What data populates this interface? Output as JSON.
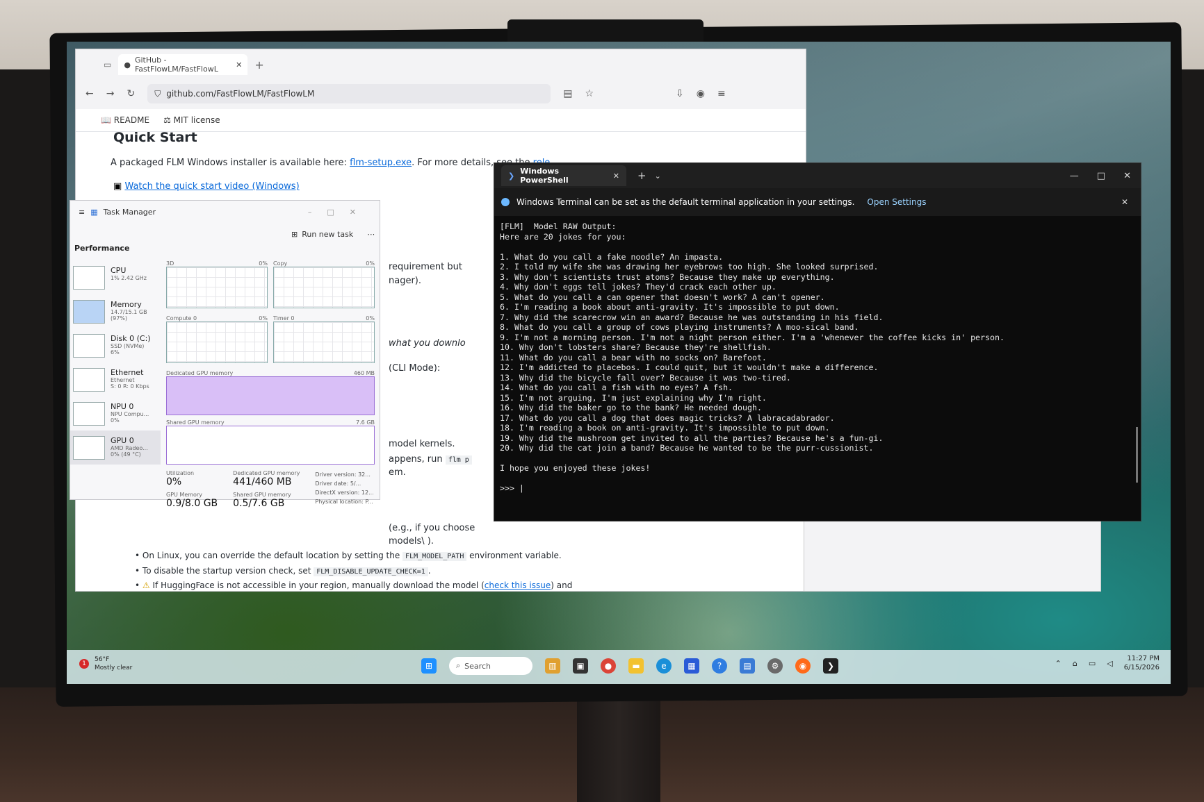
{
  "browser": {
    "tab_title": "GitHub - FastFlowLM/FastFlowL",
    "url": "github.com/FastFlowLM/FastFlowLM",
    "readme_tab": "README",
    "license_tab": "MIT license",
    "section_title": "Quick Start",
    "intro_text": "A packaged FLM Windows installer is available here:",
    "installer_link": "flm-setup.exe",
    "details_text": ". For more details, see the",
    "release_link": "rele",
    "video_link": "Watch the quick start video (Windows)",
    "frag_requirement": "requirement but",
    "frag_manager": "nager).",
    "frag_download": "what you downlo",
    "frag_cli": "(CLI Mode):",
    "frag_kernels": "model kernels.",
    "frag_appens": "appens, run",
    "frag_appens_code": "flm p",
    "frag_em": "em.",
    "frag_eg": "(e.g., if you choose",
    "frag_models": "models\\ ).",
    "bullet1_pre": "On Linux, you can override the default location by setting the",
    "bullet1_code": "FLM_MODEL_PATH",
    "bullet1_post": "environment variable.",
    "bullet2_pre": "To disable the startup version check, set",
    "bullet2_code": "FLM_DISABLE_UPDATE_CHECK=1",
    "bullet2_post": ".",
    "bullet3_pre": "If HuggingFace is not accessible in your region, manually download the model (",
    "bullet3_link": "check this issue",
    "bullet3_post": ") and"
  },
  "taskmgr": {
    "title": "Task Manager",
    "run_new_task": "Run new task",
    "performance": "Performance",
    "side": [
      {
        "name": "CPU",
        "sub1": "1% 2.42 GHz",
        "sub2": ""
      },
      {
        "name": "Memory",
        "sub1": "14.7/15.1 GB (97%)",
        "sub2": ""
      },
      {
        "name": "Disk 0 (C:)",
        "sub1": "SSD (NVMe)",
        "sub2": "6%"
      },
      {
        "name": "Ethernet",
        "sub1": "Ethernet",
        "sub2": "S: 0 R: 0 Kbps"
      },
      {
        "name": "NPU 0",
        "sub1": "NPU Compu...",
        "sub2": "0%"
      },
      {
        "name": "GPU 0",
        "sub1": "AMD Radeo...",
        "sub2": "0% (49 °C)"
      }
    ],
    "g_3d": "3D",
    "g_3d_pct": "0%",
    "g_copy": "Copy",
    "g_copy_pct": "0%",
    "g_compute": "Compute 0",
    "g_compute_pct": "0%",
    "g_timer": "Timer 0",
    "g_timer_pct": "0%",
    "dedicated_label": "Dedicated GPU memory",
    "dedicated_max": "460 MB",
    "shared_label": "Shared GPU memory",
    "shared_max": "7.6 GB",
    "stat_util_label": "Utilization",
    "stat_util": "0%",
    "stat_ded_label": "Dedicated GPU memory",
    "stat_ded": "441/460 MB",
    "stat_gpumem_label": "GPU Memory",
    "stat_gpumem": "0.9/8.0 GB",
    "stat_shared_label": "Shared GPU memory",
    "stat_shared": "0.5/7.6 GB",
    "driver_version_label": "Driver version:",
    "driver_version": "32...",
    "driver_date_label": "Driver date:",
    "driver_date": "5/...",
    "directx_label": "DirectX version:",
    "directx": "12...",
    "physical_label": "Physical location:",
    "physical": "P..."
  },
  "terminal": {
    "tab_title": "Windows PowerShell",
    "banner_text": "Windows Terminal can be set as the default terminal application in your settings.",
    "banner_link": "Open Settings",
    "lines": [
      "[FLM]  Model RAW Output:",
      "Here are 20 jokes for you:",
      "",
      "1. What do you call a fake noodle? An impasta.",
      "2. I told my wife she was drawing her eyebrows too high. She looked surprised.",
      "3. Why don't scientists trust atoms? Because they make up everything.",
      "4. Why don't eggs tell jokes? They'd crack each other up.",
      "5. What do you call a can opener that doesn't work? A can't opener.",
      "6. I'm reading a book about anti-gravity. It's impossible to put down.",
      "7. Why did the scarecrow win an award? Because he was outstanding in his field.",
      "8. What do you call a group of cows playing instruments? A moo-sical band.",
      "9. I'm not a morning person. I'm not a night person either. I'm a 'whenever the coffee kicks in' person.",
      "10. Why don't lobsters share? Because they're shellfish.",
      "11. What do you call a bear with no socks on? Barefoot.",
      "12. I'm addicted to placebos. I could quit, but it wouldn't make a difference.",
      "13. Why did the bicycle fall over? Because it was two-tired.",
      "14. What do you call a fish with no eyes? A fsh.",
      "15. I'm not arguing, I'm just explaining why I'm right.",
      "16. Why did the baker go to the bank? He needed dough.",
      "17. What do you call a dog that does magic tricks? A labracadabrador.",
      "18. I'm reading a book on anti-gravity. It's impossible to put down.",
      "19. Why did the mushroom get invited to all the parties? Because he's a fun-gi.",
      "20. Why did the cat join a band? Because he wanted to be the purr-cussionist.",
      "",
      "I hope you enjoyed these jokes!",
      "",
      ">>> |"
    ]
  },
  "taskbar": {
    "weather_badge": "1",
    "temp": "56°F",
    "condition": "Mostly clear",
    "search_placeholder": "Search",
    "time": "11:27 PM",
    "date": "6/15/2026"
  },
  "colors": {
    "accent": "#0969da",
    "terminal_bg": "#0c0c0c",
    "gpu_mem_fill": "#d9bff7"
  },
  "icons": [
    "windows-icon",
    "search-icon",
    "chrome-icon",
    "edge-icon",
    "file-explorer-icon",
    "firefox-icon",
    "terminal-icon",
    "settings-icon"
  ]
}
